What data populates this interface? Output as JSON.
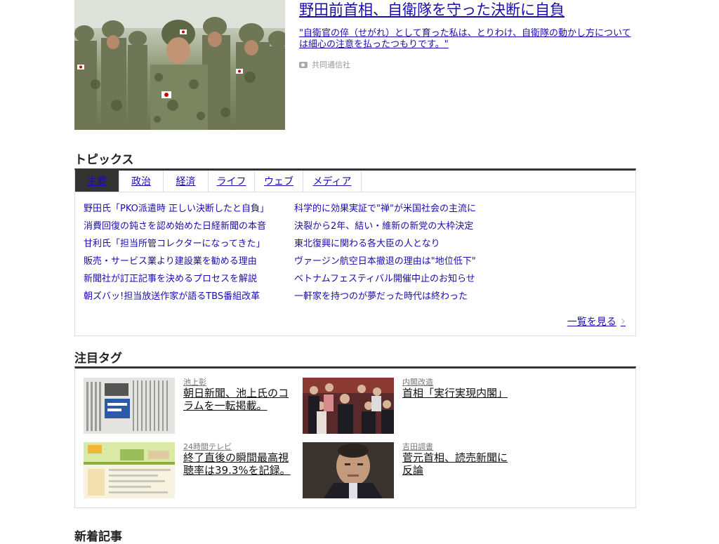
{
  "hero": {
    "title": "野田前首相、自衛隊を守った決断に自負",
    "lead": "\"自衛官の倅（せがれ）として育った私は、とりわけ、自衛隊の動かし方については細心の注意を払ったつもりです。\"",
    "credit": "共同通信社",
    "photo_icon": "camera-icon"
  },
  "topics": {
    "title": "トピックス",
    "tabs": [
      "主要",
      "政治",
      "経済",
      "ライフ",
      "ウェブ",
      "メディア"
    ],
    "active_tab": 0,
    "left": [
      "野田氏「PKO派遣時 正しい決断したと自負」",
      "消費回復の鈍さを認め始めた日経新聞の本音",
      "甘利氏「担当所管コレクターになってきた」",
      "販売・サービス業より建設業を勧める理由",
      "新聞社が訂正記事を決めるプロセスを解説",
      "朝ズバッ!担当放送作家が語るTBS番組改革"
    ],
    "right": [
      "科学的に効果実証で\"禅\"が米国社会の主流に",
      "決裂から2年、結い・維新の新党の大枠決定",
      "東北復興に関わる各大臣の人となり",
      "ヴァージン航空日本撤退の理由は\"地位低下\"",
      "ベトナムフェスティバル開催中止のお知らせ",
      "一軒家を持つのが夢だった時代は終わった"
    ],
    "more": "一覧を見る"
  },
  "tags": {
    "title": "注目タグ",
    "items": [
      {
        "tag": "池上彰",
        "text": "朝日新聞、池上氏のコラムを一転掲載。"
      },
      {
        "tag": "内閣改造",
        "text": "首相「実行実現内閣」"
      },
      {
        "tag": "24時間テレビ",
        "text": "終了直後の瞬間最高視聴率は39.3%を記録。"
      },
      {
        "tag": "吉田調書",
        "text": "菅元首相、読売新聞に反論"
      }
    ]
  },
  "new_articles": {
    "title": "新着記事"
  },
  "colors": {
    "link": "#1a0dab",
    "rule": "#333333",
    "border": "#dddddd"
  }
}
